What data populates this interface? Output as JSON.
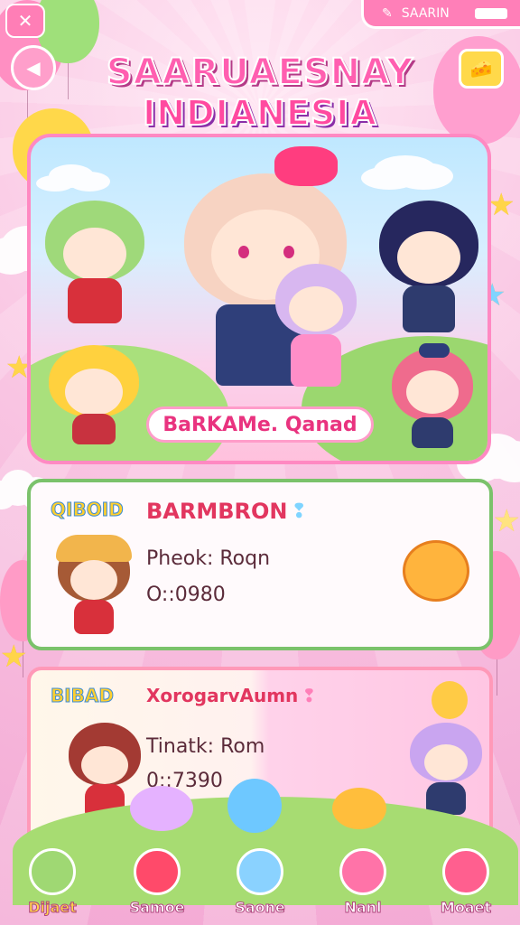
{
  "header": {
    "menu_label": "SAARIN",
    "back_icon": "back-arrow-icon",
    "bone_icon": "tools-icon",
    "cheese_icon": "cheese-icon"
  },
  "title": {
    "line1": "SAARUAESNAY",
    "line2": "INDIANESIA"
  },
  "hero": {
    "label": "BaRKAMe. Qanad"
  },
  "cards": [
    {
      "tag": "QIBOID",
      "title": "BARMBRON",
      "line1": "Pheok: Roqn",
      "line2": "O::0980"
    },
    {
      "tag": "BIBAD",
      "title": "XorogarvAumn",
      "line1": "Tinatk: Rom",
      "line2": "0::7390"
    }
  ],
  "bottom_nav": [
    {
      "label": "Dijaet",
      "icon": "microphone-icon"
    },
    {
      "label": "Samoe",
      "icon": "heart-balloon-icon"
    },
    {
      "label": "Saone",
      "icon": "bubble-icon"
    },
    {
      "label": "Nanl",
      "icon": "lollipops-icon"
    },
    {
      "label": "Moaet",
      "icon": "flower-icon"
    }
  ],
  "colors": {
    "accent_pink": "#ff7fb8",
    "card1_border": "#7bc26b",
    "card2_border": "#ff99b8",
    "title_pink": "#ff5fb0"
  }
}
